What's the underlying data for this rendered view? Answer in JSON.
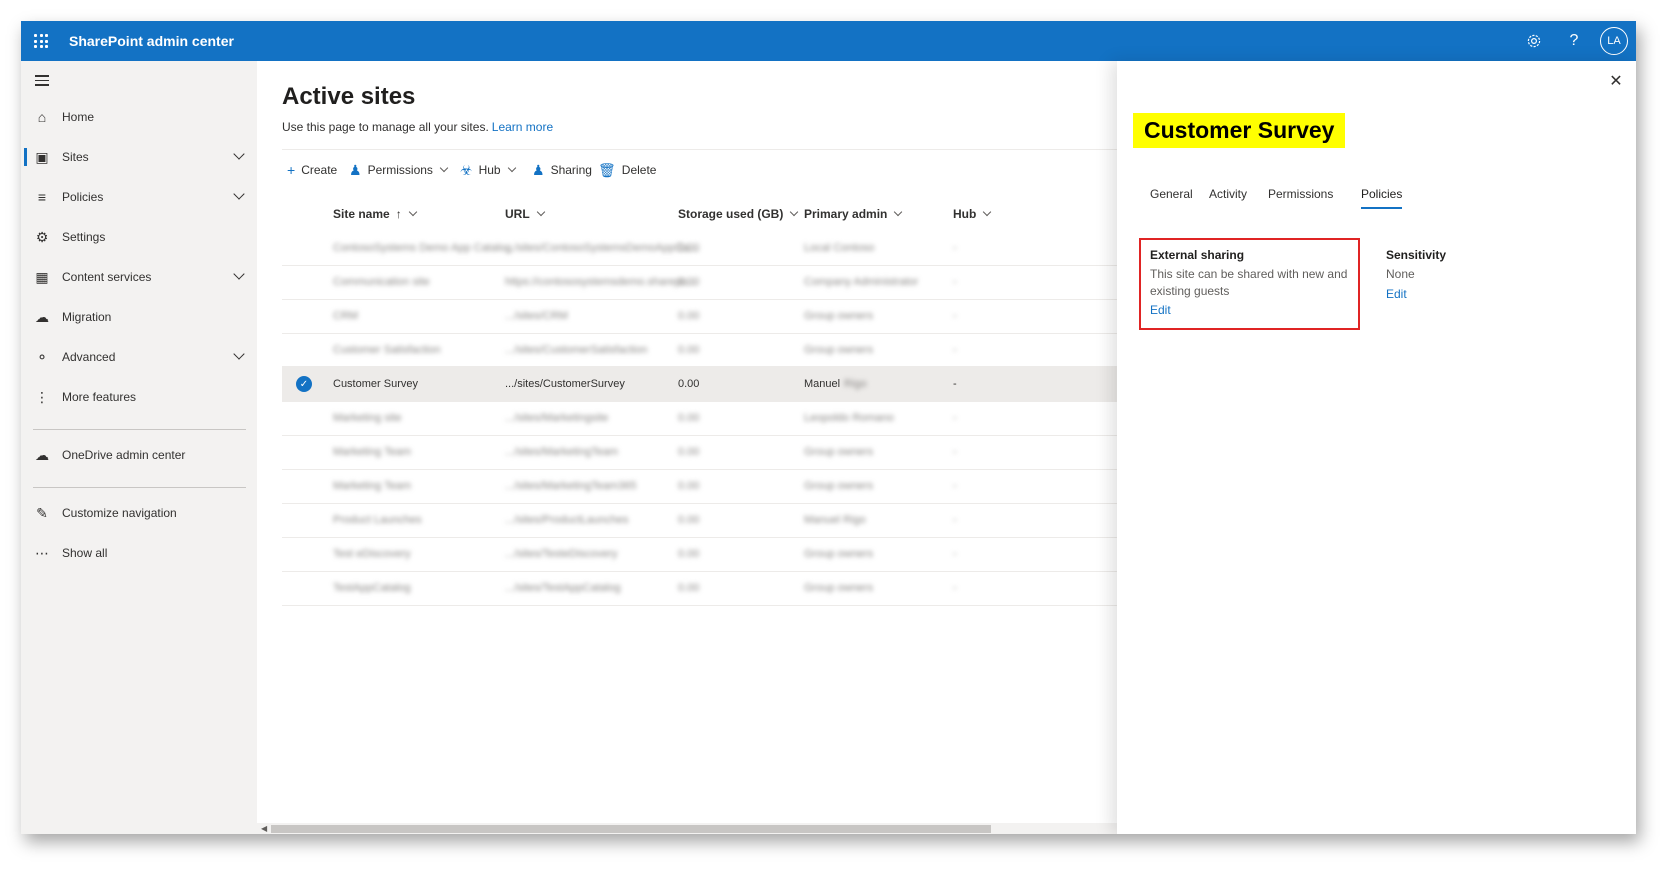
{
  "app": {
    "title": "SharePoint admin center",
    "avatar_initials": "LA"
  },
  "topbar_icons": [
    "gear-icon",
    "help-icon"
  ],
  "nav": {
    "items": [
      {
        "label": "Home",
        "icon": "home-icon"
      },
      {
        "label": "Sites",
        "icon": "sites-icon"
      },
      {
        "label": "Policies",
        "icon": "policies-icon"
      },
      {
        "label": "Settings",
        "icon": "gear-icon"
      },
      {
        "label": "Content services",
        "icon": "content-services-icon"
      },
      {
        "label": "Migration",
        "icon": "cloud-upload-icon"
      },
      {
        "label": "Advanced",
        "icon": "advanced-icon"
      },
      {
        "label": "More features",
        "icon": "more-vertical-icon"
      },
      {
        "label": "OneDrive admin center",
        "icon": "onedrive-icon"
      },
      {
        "label": "Customize navigation",
        "icon": "pencil-icon"
      },
      {
        "label": "Show all",
        "icon": "ellipsis-icon"
      }
    ]
  },
  "main": {
    "title": "Active sites",
    "subtitle": "Use this page to manage all your sites.",
    "learn_more": "Learn more",
    "commands": [
      "Create",
      "Permissions",
      "Hub",
      "Sharing",
      "Delete"
    ],
    "columns": [
      "Site name",
      "URL",
      "Storage used (GB)",
      "Primary admin",
      "Hub"
    ],
    "rows": [
      {
        "name": "ContosoSystems Demo App Catalog",
        "url": ".../sites/ContosoSystemsDemoAppCa...",
        "storage": "0.00",
        "admin": "Local Contoso",
        "hub": "-"
      },
      {
        "name": "Communication site",
        "url": "https://contososystemsdemo.sharepo...",
        "storage": "0.00",
        "admin": "Company Administrator",
        "hub": "-"
      },
      {
        "name": "CRM",
        "url": ".../sites/CRM",
        "storage": "0.00",
        "admin": "Group owners",
        "hub": "-"
      },
      {
        "name": "Customer Satisfaction",
        "url": ".../sites/CustomerSatisfaction",
        "storage": "0.00",
        "admin": "Group owners",
        "hub": "-"
      },
      {
        "name": "Customer Survey",
        "url": ".../sites/CustomerSurvey",
        "storage": "0.00",
        "admin": "Manuel",
        "admin_hidden": "Rigo",
        "hub": "-",
        "selected": true
      },
      {
        "name": "Marketing site",
        "url": ".../sites/Marketingsite",
        "storage": "0.00",
        "admin": "Leopoldo Romano",
        "hub": "-"
      },
      {
        "name": "Marketing Team",
        "url": ".../sites/MarketingTeam",
        "storage": "0.00",
        "admin": "Group owners",
        "hub": "-"
      },
      {
        "name": "Marketing Team",
        "url": ".../sites/MarketingTeam365",
        "storage": "0.00",
        "admin": "Group owners",
        "hub": "-"
      },
      {
        "name": "Product Launches",
        "url": ".../sites/ProductLaunches",
        "storage": "0.00",
        "admin": "Manuel Rigo",
        "hub": "-"
      },
      {
        "name": "Test eDiscovery",
        "url": ".../sites/TesteDiscovery",
        "storage": "0.00",
        "admin": "Group owners",
        "hub": "-"
      },
      {
        "name": "TestAppCatalog",
        "url": ".../sites/TestAppCatalog",
        "storage": "0.00",
        "admin": "Group owners",
        "hub": "-"
      }
    ]
  },
  "panel": {
    "title": "Customer Survey",
    "tabs": [
      "General",
      "Activity",
      "Permissions",
      "Policies"
    ],
    "active_tab": "Policies",
    "external_sharing": {
      "title": "External sharing",
      "text_line1": "This site can be shared with new and",
      "text_line2": "existing guests",
      "edit": "Edit"
    },
    "sensitivity": {
      "title": "Sensitivity",
      "value": "None",
      "edit": "Edit"
    }
  },
  "colors": {
    "brand": "#1372c4",
    "highlight": "#ffff00",
    "callout_border": "#e02424"
  }
}
